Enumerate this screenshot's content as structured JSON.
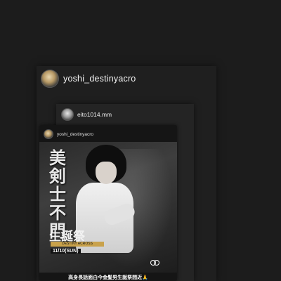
{
  "repost": {
    "username": "yoshi_destinyacro",
    "avatar_icon": "avatar-logo-icon"
  },
  "inner_post": {
    "username": "eito1014.mm",
    "avatar_icon": "avatar-photo-icon"
  },
  "story": {
    "username": "yoshi_destinyacro",
    "poster": {
      "calligraphy": "美剣士不門",
      "event_title": "生誕祭",
      "event_sub": "DESTINY ACROSS",
      "event_date": "11/10(SUN)",
      "brand_icon": "infinity-logo-icon"
    },
    "caption": "高身長話面白今金髪男生誕祭間近🙏"
  }
}
